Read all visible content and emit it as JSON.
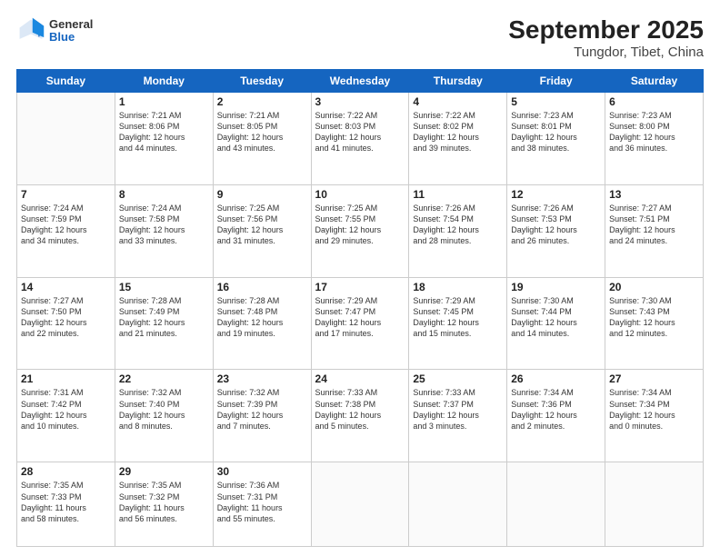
{
  "header": {
    "logo": {
      "general": "General",
      "blue": "Blue"
    },
    "title": "September 2025",
    "subtitle": "Tungdor, Tibet, China"
  },
  "weekdays": [
    "Sunday",
    "Monday",
    "Tuesday",
    "Wednesday",
    "Thursday",
    "Friday",
    "Saturday"
  ],
  "weeks": [
    [
      {
        "day": "",
        "text": ""
      },
      {
        "day": "1",
        "text": "Sunrise: 7:21 AM\nSunset: 8:06 PM\nDaylight: 12 hours\nand 44 minutes."
      },
      {
        "day": "2",
        "text": "Sunrise: 7:21 AM\nSunset: 8:05 PM\nDaylight: 12 hours\nand 43 minutes."
      },
      {
        "day": "3",
        "text": "Sunrise: 7:22 AM\nSunset: 8:03 PM\nDaylight: 12 hours\nand 41 minutes."
      },
      {
        "day": "4",
        "text": "Sunrise: 7:22 AM\nSunset: 8:02 PM\nDaylight: 12 hours\nand 39 minutes."
      },
      {
        "day": "5",
        "text": "Sunrise: 7:23 AM\nSunset: 8:01 PM\nDaylight: 12 hours\nand 38 minutes."
      },
      {
        "day": "6",
        "text": "Sunrise: 7:23 AM\nSunset: 8:00 PM\nDaylight: 12 hours\nand 36 minutes."
      }
    ],
    [
      {
        "day": "7",
        "text": "Sunrise: 7:24 AM\nSunset: 7:59 PM\nDaylight: 12 hours\nand 34 minutes."
      },
      {
        "day": "8",
        "text": "Sunrise: 7:24 AM\nSunset: 7:58 PM\nDaylight: 12 hours\nand 33 minutes."
      },
      {
        "day": "9",
        "text": "Sunrise: 7:25 AM\nSunset: 7:56 PM\nDaylight: 12 hours\nand 31 minutes."
      },
      {
        "day": "10",
        "text": "Sunrise: 7:25 AM\nSunset: 7:55 PM\nDaylight: 12 hours\nand 29 minutes."
      },
      {
        "day": "11",
        "text": "Sunrise: 7:26 AM\nSunset: 7:54 PM\nDaylight: 12 hours\nand 28 minutes."
      },
      {
        "day": "12",
        "text": "Sunrise: 7:26 AM\nSunset: 7:53 PM\nDaylight: 12 hours\nand 26 minutes."
      },
      {
        "day": "13",
        "text": "Sunrise: 7:27 AM\nSunset: 7:51 PM\nDaylight: 12 hours\nand 24 minutes."
      }
    ],
    [
      {
        "day": "14",
        "text": "Sunrise: 7:27 AM\nSunset: 7:50 PM\nDaylight: 12 hours\nand 22 minutes."
      },
      {
        "day": "15",
        "text": "Sunrise: 7:28 AM\nSunset: 7:49 PM\nDaylight: 12 hours\nand 21 minutes."
      },
      {
        "day": "16",
        "text": "Sunrise: 7:28 AM\nSunset: 7:48 PM\nDaylight: 12 hours\nand 19 minutes."
      },
      {
        "day": "17",
        "text": "Sunrise: 7:29 AM\nSunset: 7:47 PM\nDaylight: 12 hours\nand 17 minutes."
      },
      {
        "day": "18",
        "text": "Sunrise: 7:29 AM\nSunset: 7:45 PM\nDaylight: 12 hours\nand 15 minutes."
      },
      {
        "day": "19",
        "text": "Sunrise: 7:30 AM\nSunset: 7:44 PM\nDaylight: 12 hours\nand 14 minutes."
      },
      {
        "day": "20",
        "text": "Sunrise: 7:30 AM\nSunset: 7:43 PM\nDaylight: 12 hours\nand 12 minutes."
      }
    ],
    [
      {
        "day": "21",
        "text": "Sunrise: 7:31 AM\nSunset: 7:42 PM\nDaylight: 12 hours\nand 10 minutes."
      },
      {
        "day": "22",
        "text": "Sunrise: 7:32 AM\nSunset: 7:40 PM\nDaylight: 12 hours\nand 8 minutes."
      },
      {
        "day": "23",
        "text": "Sunrise: 7:32 AM\nSunset: 7:39 PM\nDaylight: 12 hours\nand 7 minutes."
      },
      {
        "day": "24",
        "text": "Sunrise: 7:33 AM\nSunset: 7:38 PM\nDaylight: 12 hours\nand 5 minutes."
      },
      {
        "day": "25",
        "text": "Sunrise: 7:33 AM\nSunset: 7:37 PM\nDaylight: 12 hours\nand 3 minutes."
      },
      {
        "day": "26",
        "text": "Sunrise: 7:34 AM\nSunset: 7:36 PM\nDaylight: 12 hours\nand 2 minutes."
      },
      {
        "day": "27",
        "text": "Sunrise: 7:34 AM\nSunset: 7:34 PM\nDaylight: 12 hours\nand 0 minutes."
      }
    ],
    [
      {
        "day": "28",
        "text": "Sunrise: 7:35 AM\nSunset: 7:33 PM\nDaylight: 11 hours\nand 58 minutes."
      },
      {
        "day": "29",
        "text": "Sunrise: 7:35 AM\nSunset: 7:32 PM\nDaylight: 11 hours\nand 56 minutes."
      },
      {
        "day": "30",
        "text": "Sunrise: 7:36 AM\nSunset: 7:31 PM\nDaylight: 11 hours\nand 55 minutes."
      },
      {
        "day": "",
        "text": ""
      },
      {
        "day": "",
        "text": ""
      },
      {
        "day": "",
        "text": ""
      },
      {
        "day": "",
        "text": ""
      }
    ]
  ]
}
